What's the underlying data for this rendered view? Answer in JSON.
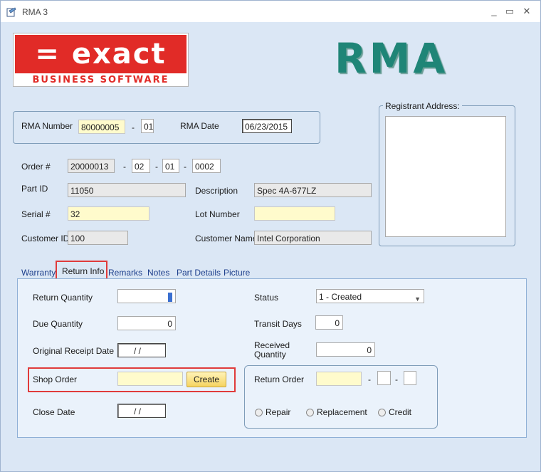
{
  "window": {
    "title": "RMA 3"
  },
  "logo": {
    "brand": "= exact",
    "tagline": "BUSINESS SOFTWARE"
  },
  "heading": "RMA",
  "rma": {
    "number_label": "RMA Number",
    "number": "80000005",
    "dash": "-",
    "suffix": "01",
    "date_label": "RMA Date",
    "date": "06/23/2015"
  },
  "registrant": {
    "label": "Registrant Address:",
    "value": ""
  },
  "order": {
    "label": "Order #",
    "number": "20000013",
    "part1": "02",
    "part2": "01",
    "part3": "0002",
    "dash": "-"
  },
  "part": {
    "id_label": "Part ID",
    "id": "11050",
    "desc_label": "Description",
    "desc": "Spec 4A-677LZ"
  },
  "serial": {
    "label": "Serial #",
    "value": "32",
    "lot_label": "Lot Number",
    "lot": ""
  },
  "customer": {
    "id_label": "Customer ID",
    "id": "100",
    "name_label": "Customer Name",
    "name": "Intel Corporation"
  },
  "tabs": [
    "Warranty",
    "Return Info",
    "Remarks",
    "Notes",
    "Part Details",
    "Picture"
  ],
  "return_info": {
    "return_qty_label": "Return Quantity",
    "return_qty": "0",
    "due_qty_label": "Due Quantity",
    "due_qty": "0",
    "orig_receipt_label": "Original Receipt Date",
    "orig_receipt": "/ /",
    "shop_order_label": "Shop Order",
    "shop_order": "",
    "create_label": "Create",
    "close_date_label": "Close Date",
    "close_date": "/ /",
    "status_label": "Status",
    "status": "1 - Created",
    "transit_label": "Transit Days",
    "transit": "0",
    "received_label_1": "Received",
    "received_label_2": "Quantity",
    "received": "0",
    "return_order_label": "Return Order",
    "return_order": "",
    "return_order_2": "",
    "return_order_3": "",
    "dash": "-",
    "radios": [
      "Repair",
      "Replacement",
      "Credit"
    ]
  },
  "colors": {
    "accent_red": "#e03b3b",
    "brand_red": "#e12b27",
    "rma_teal": "#1f8577",
    "panel_bg": "#dbe7f5"
  }
}
